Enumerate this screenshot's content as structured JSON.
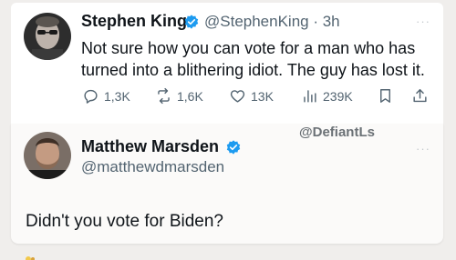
{
  "tweet": {
    "author_name": "Stephen King",
    "handle_time": "@StephenKing · 3h",
    "text": "Not sure how you can vote for a man who has turned into a blithering idiot. The guy has lost it.",
    "more": "···",
    "actions": {
      "replies": "1,3K",
      "reposts": "1,6K",
      "likes": "13K",
      "views": "239K"
    }
  },
  "watermark": "@DefiantLs",
  "reply": {
    "author_name": "Matthew Marsden",
    "handle": "@matthewdmarsden",
    "more": "···",
    "text": "Didn't you vote for Biden?"
  },
  "colors": {
    "verified": "#1d9bf0",
    "muted_text": "#536471",
    "card_bg": "#ffffff",
    "page_bg": "#f0eeec"
  },
  "icons": [
    "reply-icon",
    "repost-icon",
    "like-icon",
    "views-icon",
    "bookmark-icon",
    "share-icon",
    "verified-badge-icon",
    "more-icon"
  ]
}
